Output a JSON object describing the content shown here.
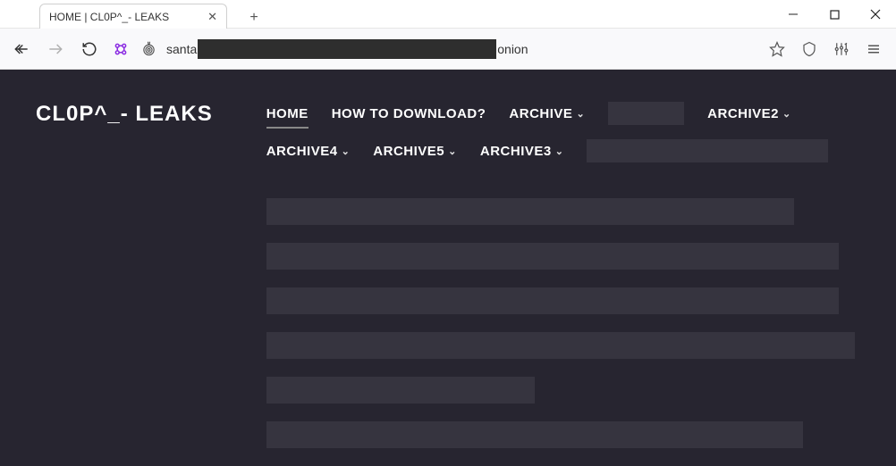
{
  "tab": {
    "title": "HOME | CL0P^_- LEAKS"
  },
  "url": {
    "prefix": "santa",
    "suffix": "onion"
  },
  "brand": "CL0P^_- LEAKS",
  "nav": {
    "row1": [
      {
        "label": "HOME",
        "active": true,
        "dropdown": false
      },
      {
        "label": "HOW TO DOWNLOAD?",
        "dropdown": false
      },
      {
        "label": "ARCHIVE",
        "dropdown": true
      },
      {
        "label": "ARCHIVE2",
        "dropdown": true
      }
    ],
    "row2": [
      {
        "label": "ARCHIVE4",
        "dropdown": true
      },
      {
        "label": "ARCHIVE5",
        "dropdown": true
      },
      {
        "label": "ARCHIVE3",
        "dropdown": true
      }
    ]
  }
}
